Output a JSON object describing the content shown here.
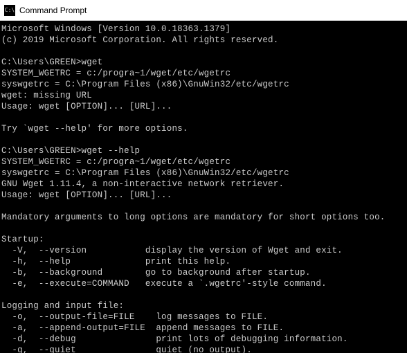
{
  "window": {
    "title": "Command Prompt",
    "icon_label": "C:\\"
  },
  "terminal": {
    "lines": [
      "Microsoft Windows [Version 10.0.18363.1379]",
      "(c) 2019 Microsoft Corporation. All rights reserved.",
      "",
      "C:\\Users\\GREEN>wget",
      "SYSTEM_WGETRC = c:/progra~1/wget/etc/wgetrc",
      "syswgetrc = C:\\Program Files (x86)\\GnuWin32/etc/wgetrc",
      "wget: missing URL",
      "Usage: wget [OPTION]... [URL]...",
      "",
      "Try `wget --help' for more options.",
      "",
      "C:\\Users\\GREEN>wget --help",
      "SYSTEM_WGETRC = c:/progra~1/wget/etc/wgetrc",
      "syswgetrc = C:\\Program Files (x86)\\GnuWin32/etc/wgetrc",
      "GNU Wget 1.11.4, a non-interactive network retriever.",
      "Usage: wget [OPTION]... [URL]...",
      "",
      "Mandatory arguments to long options are mandatory for short options too.",
      "",
      "Startup:",
      "  -V,  --version           display the version of Wget and exit.",
      "  -h,  --help              print this help.",
      "  -b,  --background        go to background after startup.",
      "  -e,  --execute=COMMAND   execute a `.wgetrc'-style command.",
      "",
      "Logging and input file:",
      "  -o,  --output-file=FILE    log messages to FILE.",
      "  -a,  --append-output=FILE  append messages to FILE.",
      "  -d,  --debug               print lots of debugging information.",
      "  -q,  --quiet               quiet (no output)."
    ]
  }
}
